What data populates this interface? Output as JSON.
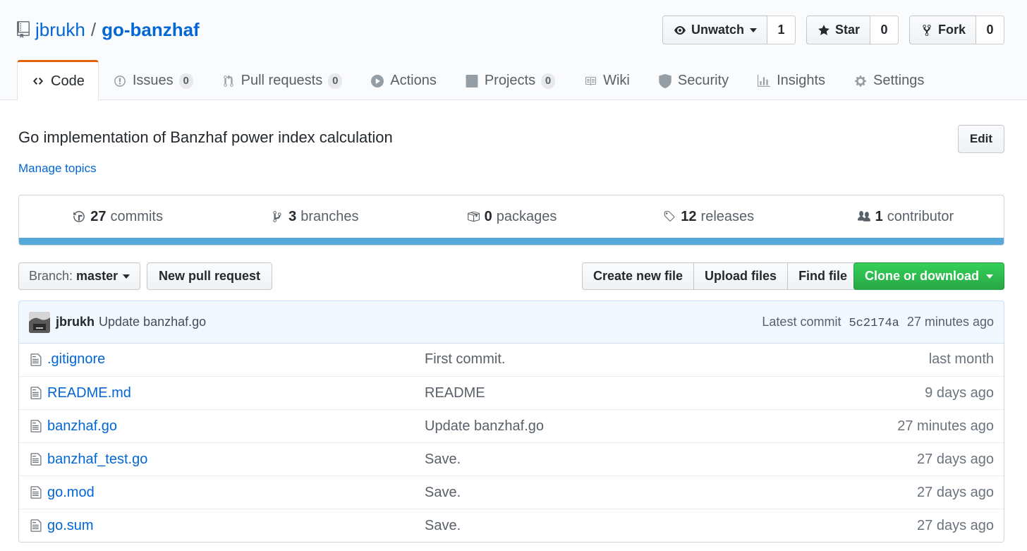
{
  "repo": {
    "owner": "jbrukh",
    "separator": "/",
    "name": "go-banzhaf"
  },
  "actions": {
    "watch": {
      "label": "Unwatch",
      "count": "1"
    },
    "star": {
      "label": "Star",
      "count": "0"
    },
    "fork": {
      "label": "Fork",
      "count": "0"
    }
  },
  "nav": {
    "code": "Code",
    "issues": "Issues",
    "issues_count": "0",
    "pulls": "Pull requests",
    "pulls_count": "0",
    "actions": "Actions",
    "projects": "Projects",
    "projects_count": "0",
    "wiki": "Wiki",
    "security": "Security",
    "insights": "Insights",
    "settings": "Settings"
  },
  "description": "Go implementation of Banzhaf power index calculation",
  "manage_topics": "Manage topics",
  "edit_label": "Edit",
  "summary": {
    "commits": {
      "num": "27",
      "label": "commits"
    },
    "branches": {
      "num": "3",
      "label": "branches"
    },
    "packages": {
      "num": "0",
      "label": "packages"
    },
    "releases": {
      "num": "12",
      "label": "releases"
    },
    "contributors": {
      "num": "1",
      "label": "contributor"
    },
    "language_color": "#56a8d8"
  },
  "branch": {
    "prefix": "Branch:",
    "name": "master"
  },
  "new_pull_request": "New pull request",
  "file_actions": {
    "create": "Create new file",
    "upload": "Upload files",
    "find": "Find file"
  },
  "clone_label": "Clone or download",
  "latest_commit": {
    "author": "jbrukh",
    "message": "Update banzhaf.go",
    "prefix": "Latest commit",
    "sha": "5c2174a",
    "age": "27 minutes ago"
  },
  "files": [
    {
      "name": ".gitignore",
      "message": "First commit.",
      "age": "last month"
    },
    {
      "name": "README.md",
      "message": "README",
      "age": "9 days ago"
    },
    {
      "name": "banzhaf.go",
      "message": "Update banzhaf.go",
      "age": "27 minutes ago"
    },
    {
      "name": "banzhaf_test.go",
      "message": "Save.",
      "age": "27 days ago"
    },
    {
      "name": "go.mod",
      "message": "Save.",
      "age": "27 days ago"
    },
    {
      "name": "go.sum",
      "message": "Save.",
      "age": "27 days ago"
    }
  ]
}
